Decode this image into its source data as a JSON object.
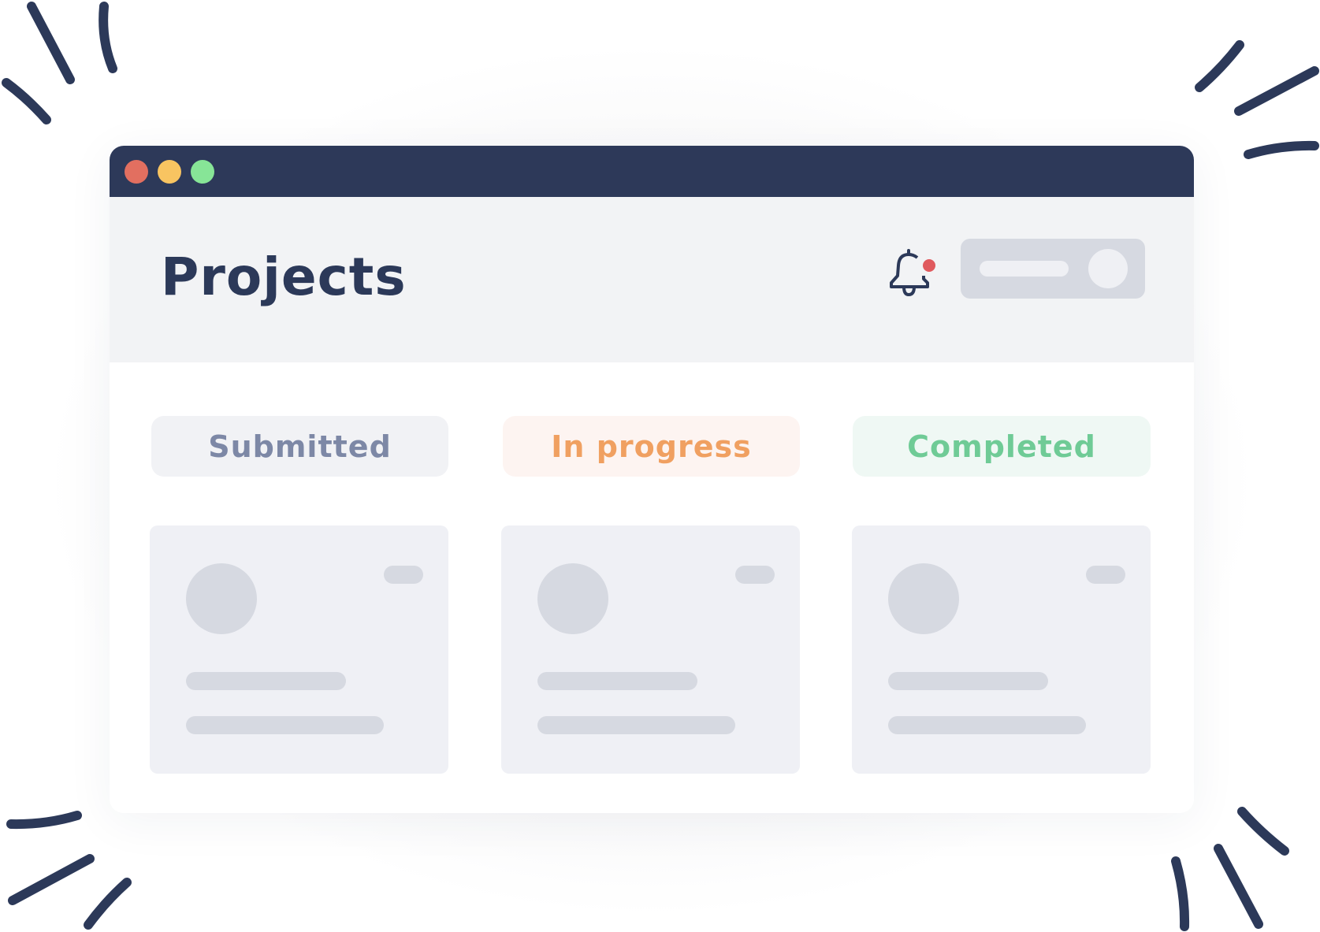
{
  "window": {
    "controls": [
      {
        "name": "close",
        "color": "#e26f60"
      },
      {
        "name": "minimize",
        "color": "#f8c461"
      },
      {
        "name": "maximize",
        "color": "#87e597"
      }
    ],
    "titlebar_color": "#2d3959"
  },
  "header": {
    "title": "Projects",
    "notification_icon": "bell-icon",
    "notification_badge_color": "#e05a5e",
    "user_menu": {
      "icon": "avatar-placeholder"
    }
  },
  "columns": [
    {
      "label": "Submitted",
      "text_color": "#7d88a6",
      "bg_color": "#f1f2f5",
      "card": {
        "avatar": "avatar-placeholder",
        "tag": "tag-placeholder",
        "lines": 2
      }
    },
    {
      "label": "In progress",
      "text_color": "#f0a061",
      "bg_color": "#fdf4f1",
      "card": {
        "avatar": "avatar-placeholder",
        "tag": "tag-placeholder",
        "lines": 2
      }
    },
    {
      "label": "Completed",
      "text_color": "#6fcb96",
      "bg_color": "#eff8f4",
      "card": {
        "avatar": "avatar-placeholder",
        "tag": "tag-placeholder",
        "lines": 2
      }
    }
  ],
  "decoration": {
    "ray_color": "#2c3959"
  }
}
